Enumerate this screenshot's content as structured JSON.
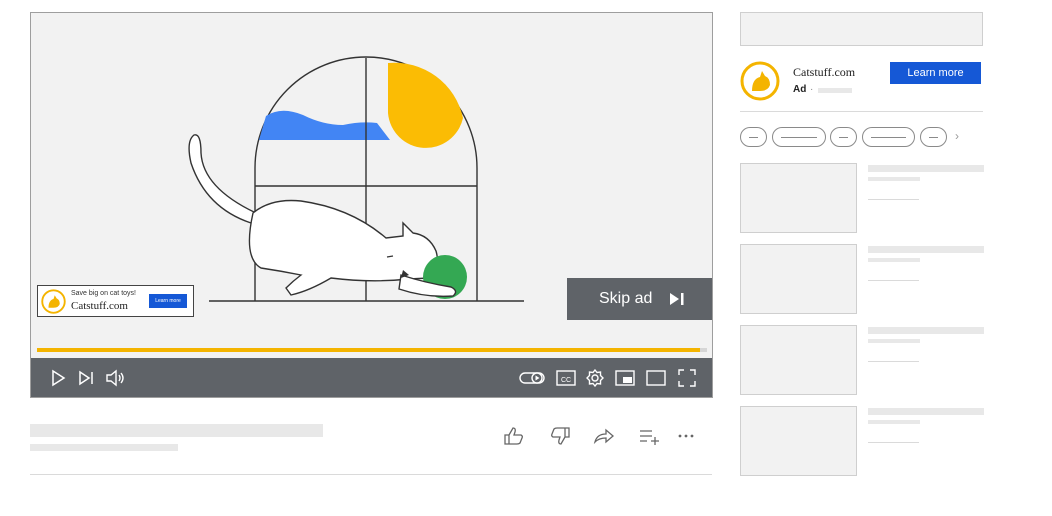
{
  "player": {
    "overlay_ad": {
      "tagline": "Save big on cat toys!",
      "site": "Catstuff.com",
      "button_label": "Learn more"
    },
    "skip_ad_label": "Skip ad",
    "progress_fraction": 0.99,
    "control_icons": [
      "play-icon",
      "next-icon",
      "volume-icon",
      "autoplay-toggle-icon",
      "captions-icon",
      "settings-gear-icon",
      "miniplayer-icon",
      "theater-mode-icon",
      "fullscreen-icon"
    ],
    "captions_label": "CC"
  },
  "video_actions": [
    "thumbs-up-icon",
    "thumbs-down-icon",
    "share-icon",
    "save-to-playlist-icon",
    "more-icon"
  ],
  "sidebar": {
    "ad": {
      "site": "Catstuff.com",
      "label": "Ad",
      "separator": "·",
      "button_label": "Learn more"
    },
    "chip_next": "›",
    "recommendation_count": 4
  },
  "colors": {
    "brand_blue": "#1558d6",
    "accent_yellow": "#f4b400",
    "control_bar": "#5f6368",
    "ball_green": "#34a853",
    "wave_blue": "#4285f4"
  }
}
